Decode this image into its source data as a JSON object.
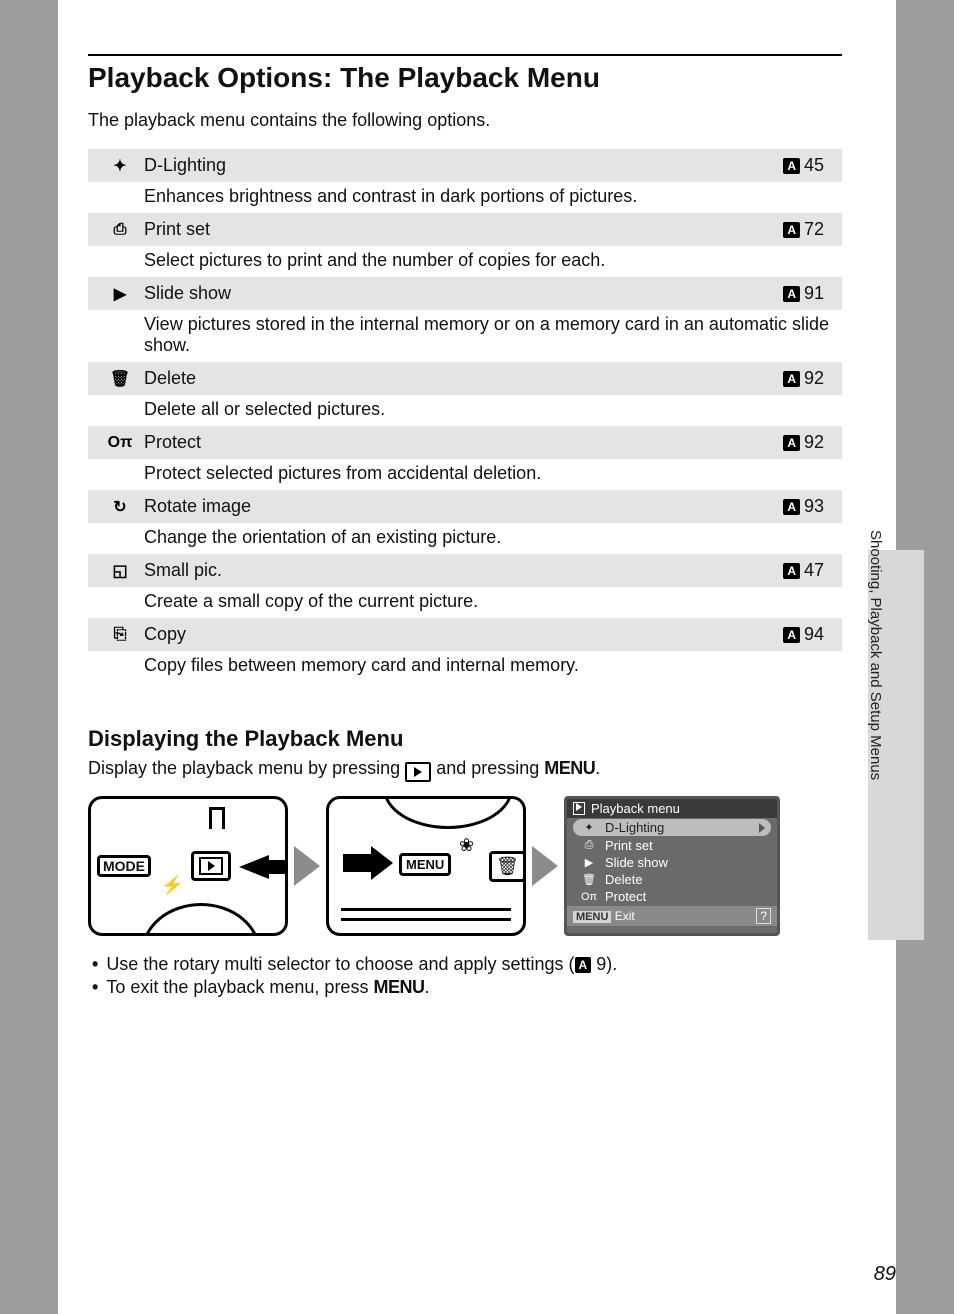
{
  "title": "Playback Options: The Playback Menu",
  "intro": "The playback menu contains the following options.",
  "ref_icon_text": "A",
  "options": [
    {
      "icon": "✦",
      "name": "D-Lighting",
      "page": "45",
      "desc": "Enhances brightness and contrast in dark portions of pictures."
    },
    {
      "icon": "⎙",
      "name": "Print set",
      "page": "72",
      "desc": "Select pictures to print and the number of copies for each."
    },
    {
      "icon": "▶",
      "name": "Slide show",
      "page": "91",
      "desc": "View pictures stored in the internal memory or on a memory card in an automatic slide show."
    },
    {
      "icon": "🗑",
      "name": "Delete",
      "page": "92",
      "desc": "Delete all or selected pictures."
    },
    {
      "icon": "Oπ",
      "name": "Protect",
      "page": "92",
      "desc": "Protect selected pictures from accidental deletion."
    },
    {
      "icon": "↻",
      "name": "Rotate image",
      "page": "93",
      "desc": "Change the orientation of an existing picture."
    },
    {
      "icon": "◱",
      "name": "Small pic.",
      "page": "47",
      "desc": "Create a small copy of the current picture."
    },
    {
      "icon": "⎘",
      "name": "Copy",
      "page": "94",
      "desc": "Copy files between memory card and internal memory."
    }
  ],
  "subheading": "Displaying the Playback Menu",
  "subtext_a": "Display the playback menu by pressing ",
  "subtext_b": " and pressing ",
  "subtext_c": ".",
  "menu_label": "MENU",
  "diagramA": {
    "mode": "MODE",
    "flash": "⚡"
  },
  "diagramB": {
    "menu": "MENU",
    "flower": "❀",
    "trash": "🗑"
  },
  "diagramC": {
    "title": "Playback menu",
    "rows": [
      {
        "icon": "✦",
        "label": "D-Lighting",
        "selected": true
      },
      {
        "icon": "⎙",
        "label": "Print set"
      },
      {
        "icon": "▶",
        "label": "Slide show"
      },
      {
        "icon": "🗑",
        "label": "Delete"
      },
      {
        "icon": "Oπ",
        "label": "Protect"
      }
    ],
    "footer_menu": "MENU",
    "footer_exit": "Exit",
    "footer_help": "?"
  },
  "notes": {
    "a_pre": "Use the rotary multi selector to choose and apply settings (",
    "a_page": "9",
    "a_post": ").",
    "b_pre": "To exit the playback menu, press ",
    "b_post": "."
  },
  "side_text": "Shooting, Playback and Setup Menus",
  "page_number": "89"
}
